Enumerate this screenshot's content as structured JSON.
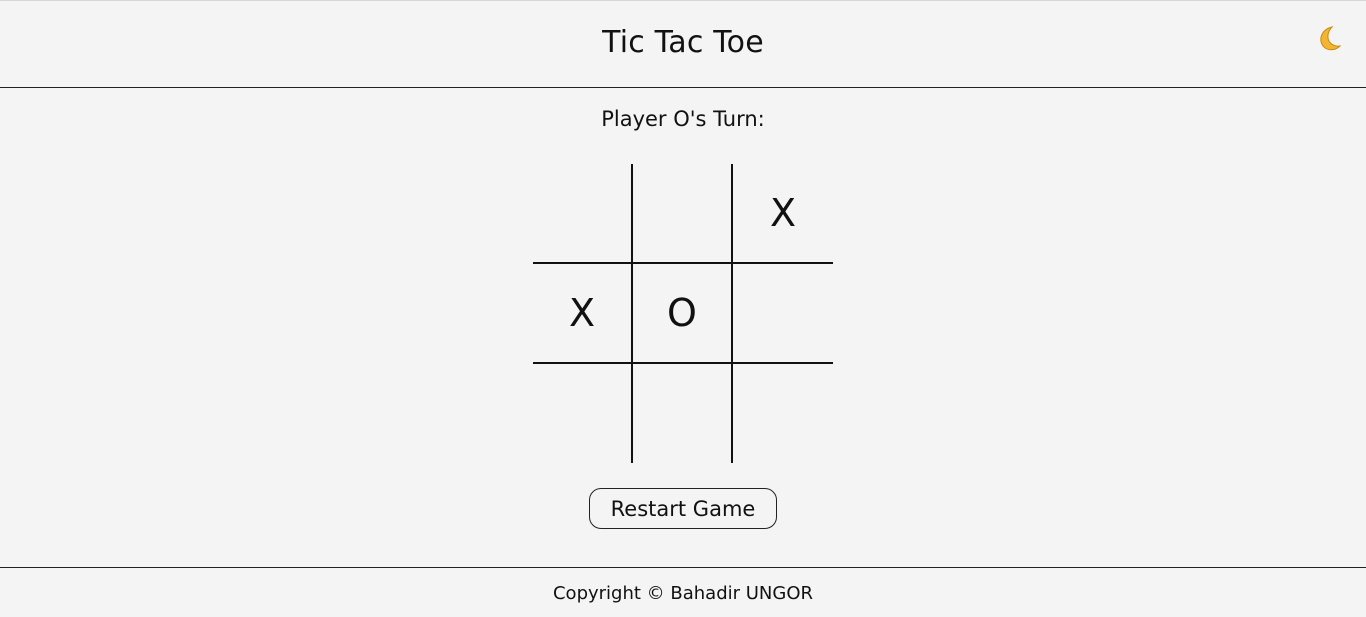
{
  "header": {
    "title": "Tic Tac Toe",
    "theme_toggle_icon": "crescent-moon-icon",
    "theme_toggle_color": "#f2b431"
  },
  "game": {
    "turn_text": "Player O's Turn:",
    "board": [
      [
        "",
        "",
        "X"
      ],
      [
        "X",
        "O",
        ""
      ],
      [
        "",
        "",
        ""
      ]
    ]
  },
  "controls": {
    "restart_label": "Restart Game"
  },
  "footer": {
    "copyright": "Copyright © Bahadir UNGOR"
  }
}
